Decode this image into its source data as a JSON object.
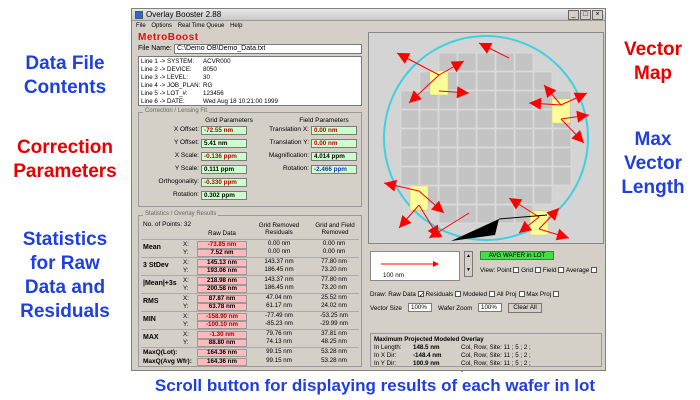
{
  "window": {
    "title": "Overlay Booster 2.88",
    "menu": [
      "File",
      "Options",
      "Real Time Queue",
      "Help"
    ],
    "min_label": "_",
    "max_label": "□",
    "close_label": "×"
  },
  "annotations": {
    "data_file_contents": "Data File\nContents",
    "correction_parameters": "Correction\nParameters",
    "statistics": "Statistics\nfor Raw\nData and\nResiduals",
    "vector_map": "Vector\nMap",
    "max_vector_length": "Max\nVector\nLength",
    "scroll_note": "Scroll button for displaying results of each wafer in lot"
  },
  "brand": "MetroBoost",
  "file_name": {
    "label": "File Name:",
    "value": "C:\\Demo OB\\Demo_Data.txt"
  },
  "file_lines": [
    {
      "k": "Line 1 -> SYSTEM:",
      "v": "ACVR000"
    },
    {
      "k": "Line 2 -> DEVICE:",
      "v": "8050"
    },
    {
      "k": "Line 3 -> LEVEL:",
      "v": "30"
    },
    {
      "k": "Line 4 -> JOB_PLAN:",
      "v": "RG"
    },
    {
      "k": "Line 5 -> LOT_#:",
      "v": "123456"
    },
    {
      "k": "Line 6 -> DATE:",
      "v": "Wed Aug 18 10:21:00 1999"
    }
  ],
  "correction": {
    "group_title": "Correction / Lensing Fit",
    "grid_header": "Grid Parameters",
    "field_header": "Field Parameters",
    "grid": [
      {
        "label": "X Offset:",
        "value": "-72.55 nm",
        "neg": true
      },
      {
        "label": "Y Offset:",
        "value": "5.41 nm",
        "neg": false
      },
      {
        "label": "X Scale:",
        "value": "-0.136 ppm",
        "neg": true
      },
      {
        "label": "Y Scale:",
        "value": "0.111 ppm",
        "neg": false
      },
      {
        "label": "Orthogonality:",
        "value": "-0.330 ppm",
        "neg": true
      },
      {
        "label": "Rotation:",
        "value": "0.302 ppm",
        "neg": false
      }
    ],
    "field": [
      {
        "label": "Translation X:",
        "value": "0.00 nm",
        "neg": true
      },
      {
        "label": "Translation Y:",
        "value": "0.00 nm",
        "neg": true
      },
      {
        "label": "Magnification:",
        "value": "4.014 ppm",
        "neg": false
      },
      {
        "label": "Rotation:",
        "value": "-2.466 ppm",
        "neg": true
      }
    ]
  },
  "statistics": {
    "group_title": "Statistics / Overlay Results",
    "num_points_label": "No. of Points:",
    "num_points": "32",
    "col_raw": "Raw Data",
    "col_grid": "Grid Removed\nResiduals",
    "col_field": "Grid and Field\nRemoved",
    "rows": [
      {
        "name": "Mean",
        "x": [
          "-73.85 nm",
          "0.00 nm",
          "0.00 nm"
        ],
        "y": [
          "7.52 nm",
          "0.00 nm",
          "0.00 nm"
        ]
      },
      {
        "name": "3 StDev",
        "x": [
          "145.13 nm",
          "143.37 nm",
          "77.80 nm"
        ],
        "y": [
          "193.06 nm",
          "186.45 nm",
          "73.20 nm"
        ]
      },
      {
        "name": "|Mean|+3s",
        "x": [
          "218.98 nm",
          "143.37 nm",
          "77.80 nm"
        ],
        "y": [
          "200.58 nm",
          "186.45 nm",
          "73.20 nm"
        ]
      },
      {
        "name": "RMS",
        "x": [
          "87.87 nm",
          "47.04 nm",
          "25.52 nm"
        ],
        "y": [
          "63.78 nm",
          "61.17 nm",
          "24.02 nm"
        ]
      },
      {
        "name": "MIN",
        "x": [
          "-158.90 nm",
          "-77.49 nm",
          "-53.25 nm"
        ],
        "y": [
          "-100.10 nm",
          "-85.23 nm",
          "-29.99 nm"
        ]
      },
      {
        "name": "MAX",
        "x": [
          "-1.30 nm",
          "79.76 nm",
          "37.81 nm"
        ],
        "y": [
          "88.80 nm",
          "74.13 nm",
          "48.25 nm"
        ]
      }
    ],
    "maxq_lot_label": "MaxQ(Lot):",
    "maxq_lot": [
      "164.36 nm",
      "99.15 nm",
      "53.28 nm"
    ],
    "maxq_avg_label": "MaxQ(Avg Wfr):",
    "maxq_avg": [
      "164.36 nm",
      "99.15 nm",
      "53.28 nm"
    ]
  },
  "controls": {
    "scale_label": "100 nm",
    "avg_label": "AVG WAFER in LOT",
    "view_label": "View:",
    "view_opts": [
      "Point",
      "Grid",
      "Field",
      "Average"
    ],
    "draw_label": "Draw:",
    "draw_opts": [
      "Raw Data",
      "Residuals",
      "Modeled",
      "All Proj",
      "Max Proj"
    ],
    "vector_size_label": "Vector Size",
    "vector_size_value": "100%",
    "wafer_zoom_label": "Wafer Zoom",
    "wafer_zoom_value": "100%",
    "clear_all": "Clear All",
    "maxproj_title": "Maximum Projected Modeled Overlay",
    "maxproj_rows": [
      {
        "label": "In Length:",
        "value": "148.5 nm",
        "loc": "Col, Row; Site: 11 ; 5 ; 2 ;"
      },
      {
        "label": "In X Dir:",
        "value": "-148.4 nm",
        "loc": "Col, Row; Site: 11 ; 5 ; 2 ;"
      },
      {
        "label": "In Y Dir:",
        "value": "100.9 nm",
        "loc": "Col, Row; Site: 11 ; 5 ; 2 ;"
      }
    ]
  },
  "colors": {
    "annotation_blue": "#1f3fe0",
    "annotation_red": "#e60000",
    "vector_red": "#ff0000",
    "highlight_yellow": "#ffff99",
    "wafer_cyan": "#40d0e0",
    "avg_green": "#44dd44"
  }
}
